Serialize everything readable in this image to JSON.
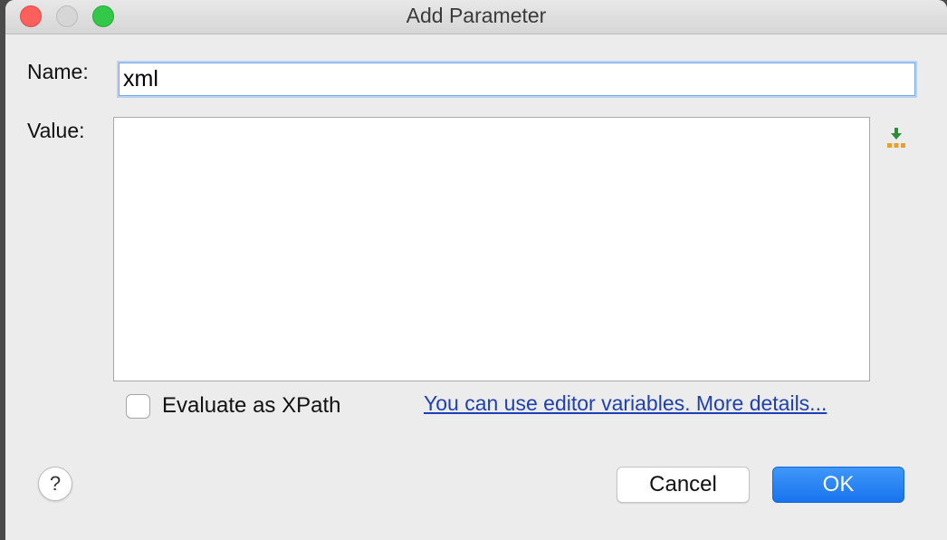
{
  "window": {
    "title": "Add Parameter"
  },
  "form": {
    "name_label": "Name:",
    "name_value": "xml",
    "value_label": "Value:",
    "value_text": "",
    "evaluate_label": "Evaluate as XPath",
    "evaluate_checked": false,
    "editor_vars_link": "You can use editor variables. More details..."
  },
  "buttons": {
    "help": "?",
    "cancel": "Cancel",
    "ok": "OK"
  },
  "icons": {
    "insert_macro": "insert-macro-icon"
  },
  "colors": {
    "ok_button": "#1874ef",
    "link": "#1f3fb6",
    "close": "#fc605c",
    "zoom": "#34c84a"
  }
}
